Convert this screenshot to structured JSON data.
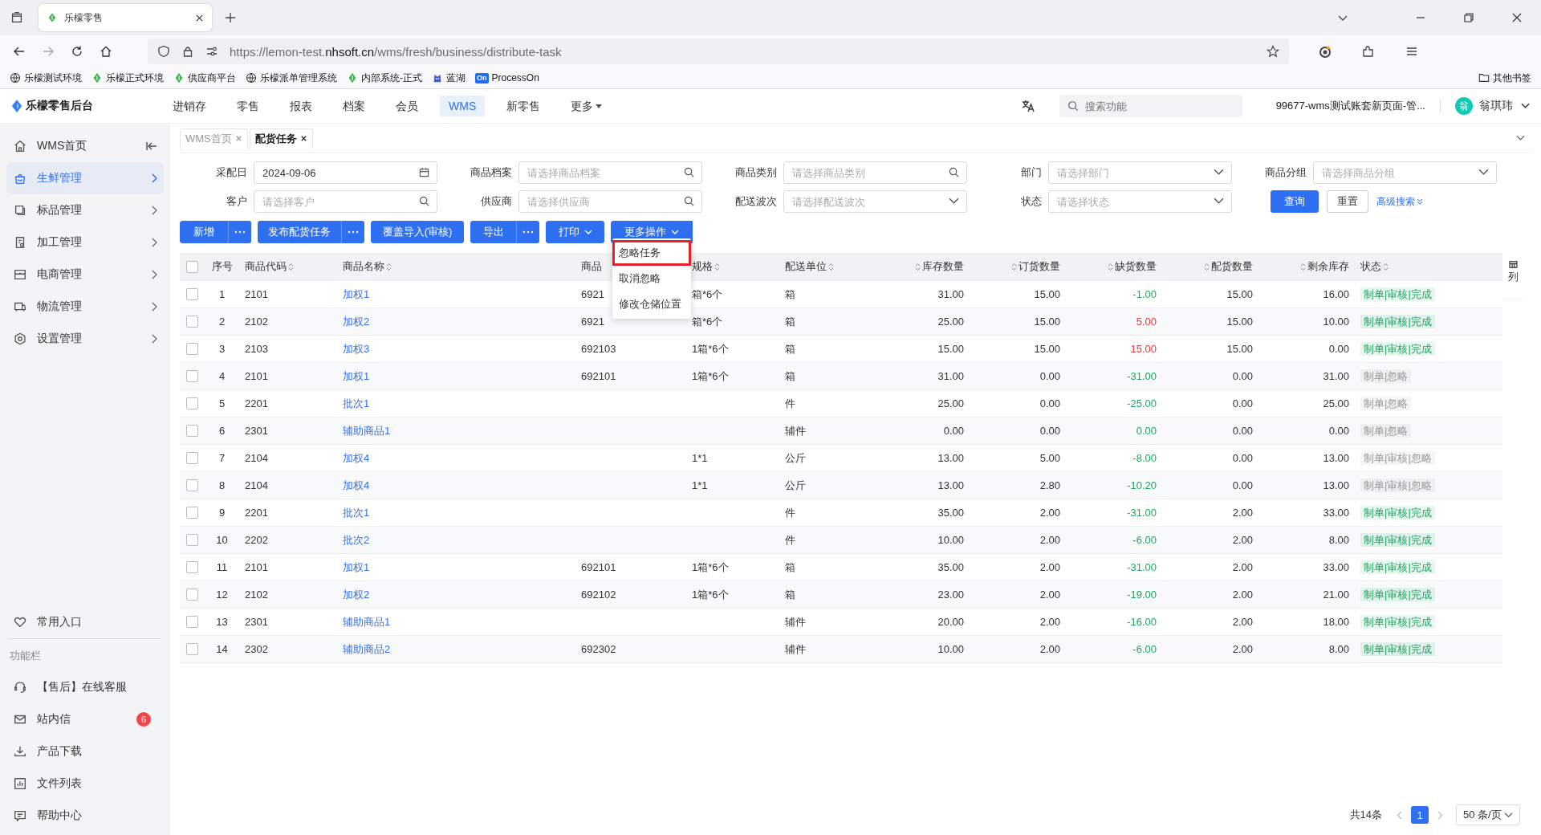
{
  "browser": {
    "tab_title": "乐檬零售",
    "url": "https://lemon-test.**nhsoft.cn**/wms/fresh/business/distribute-task",
    "bookmarks": [
      {
        "label": "乐檬测试环境",
        "kind": "globe"
      },
      {
        "label": "乐檬正式环境",
        "kind": "leaf"
      },
      {
        "label": "供应商平台",
        "kind": "leaf"
      },
      {
        "label": "乐檬派单管理系统",
        "kind": "globe"
      },
      {
        "label": "内部系统-正式",
        "kind": "leaf"
      },
      {
        "label": "蓝湖",
        "kind": "lanhu"
      },
      {
        "label": "ProcessOn",
        "kind": "processon",
        "icon_text": "On"
      }
    ],
    "other_bookmarks": "其他书签"
  },
  "app": {
    "logo": "乐檬零售后台",
    "nav": [
      {
        "label": "进销存",
        "selected": false,
        "has_caret": false
      },
      {
        "label": "零售",
        "selected": false,
        "has_caret": false
      },
      {
        "label": "报表",
        "selected": false,
        "has_caret": false
      },
      {
        "label": "档案",
        "selected": false,
        "has_caret": false
      },
      {
        "label": "会员",
        "selected": false,
        "has_caret": false
      },
      {
        "label": "WMS",
        "selected": true,
        "has_caret": false
      },
      {
        "label": "新零售",
        "selected": false,
        "has_caret": false
      },
      {
        "label": "更多",
        "selected": false,
        "has_caret": true
      }
    ],
    "search_placeholder": "搜索功能",
    "account": "99677-wms测试账套新页面-管...",
    "avatar": "翁",
    "user": "翁琪玮"
  },
  "sidebar": {
    "items": [
      {
        "label": "WMS首页",
        "kind": "home",
        "selected": false
      },
      {
        "label": "生鲜管理",
        "kind": "fresh",
        "selected": true
      },
      {
        "label": "标品管理",
        "kind": "box",
        "selected": false
      },
      {
        "label": "加工管理",
        "kind": "factory",
        "selected": false
      },
      {
        "label": "电商管理",
        "kind": "shop",
        "selected": false
      },
      {
        "label": "物流管理",
        "kind": "truck",
        "selected": false
      },
      {
        "label": "设置管理",
        "kind": "gear",
        "selected": false
      }
    ],
    "favorites": {
      "label": "常用入口",
      "kind": "heart"
    },
    "section_title": "功能栏",
    "tools": [
      {
        "label": "【售后】在线客服",
        "kind": "headset"
      },
      {
        "label": "站内信",
        "kind": "mail",
        "badge": "6"
      },
      {
        "label": "产品下载",
        "kind": "download"
      },
      {
        "label": "文件列表",
        "kind": "chart"
      },
      {
        "label": "帮助中心",
        "kind": "help"
      }
    ]
  },
  "page_tabs": [
    {
      "label": "WMS首页",
      "selected": false
    },
    {
      "label": "配货任务",
      "selected": true
    }
  ],
  "filters": [
    [
      {
        "label": "采配日",
        "value": "2024-09-06",
        "kind": "date"
      },
      {
        "label": "商品档案",
        "placeholder": "请选择商品档案",
        "kind": "search"
      },
      {
        "label": "商品类别",
        "placeholder": "请选择商品类别",
        "kind": "search"
      },
      {
        "label": "部门",
        "placeholder": "请选择部门",
        "kind": "select"
      },
      {
        "label": "商品分组",
        "placeholder": "请选择商品分组",
        "kind": "select"
      }
    ],
    [
      {
        "label": "客户",
        "placeholder": "请选择客户",
        "kind": "search"
      },
      {
        "label": "供应商",
        "placeholder": "请选择供应商",
        "kind": "search"
      },
      {
        "label": "配送波次",
        "placeholder": "请选择配送波次",
        "kind": "select"
      },
      {
        "label": "状态",
        "placeholder": "请选择状态",
        "kind": "select"
      }
    ]
  ],
  "query_button": "查询",
  "reset_button": "重置",
  "advanced_search": "高级搜索",
  "actions": [
    {
      "label": "新增",
      "has_more": true,
      "has_caret": false
    },
    {
      "label": "发布配货任务",
      "has_more": true,
      "has_caret": false
    },
    {
      "label": "覆盖导入(审核)",
      "has_more": false,
      "has_caret": false
    },
    {
      "label": "导出",
      "has_more": true,
      "has_caret": false
    },
    {
      "label": "打印",
      "has_more": false,
      "has_caret": true
    },
    {
      "label": "更多操作",
      "has_more": false,
      "has_caret": true
    }
  ],
  "more_menu": [
    {
      "label": "忽略任务",
      "highlighted": true
    },
    {
      "label": "取消忽略",
      "highlighted": false
    },
    {
      "label": "修改仓储位置",
      "highlighted": false
    }
  ],
  "table": {
    "select_all": {
      "checked": false
    },
    "columns": [
      {
        "label": "序号",
        "kind": "index",
        "sortable": false
      },
      {
        "label": "商品代码",
        "kind": "text",
        "sortable": true
      },
      {
        "label": "商品名称",
        "kind": "text",
        "sortable": true
      },
      {
        "label": "商品",
        "kind": "text",
        "sortable": false
      },
      {
        "label": "规格",
        "kind": "text",
        "sortable": true
      },
      {
        "label": "配送单位",
        "kind": "text",
        "sortable": true
      },
      {
        "label": "库存数量",
        "kind": "number",
        "sortable": true
      },
      {
        "label": "订货数量",
        "kind": "number",
        "sortable": true
      },
      {
        "label": "缺货数量",
        "kind": "number",
        "sortable": true
      },
      {
        "label": "配货数量",
        "kind": "number",
        "sortable": true
      },
      {
        "label": "剩余库存",
        "kind": "number",
        "sortable": true
      },
      {
        "label": "状态",
        "kind": "text",
        "sortable": true
      }
    ],
    "rows": [
      {
        "checked": false,
        "index": "1",
        "code": "2101",
        "name": "加权1",
        "barcode": "6921",
        "spec": "箱*6个",
        "unit": "箱",
        "stock": "31.00",
        "ordered": "15.00",
        "shortage": {
          "text": "-1.00",
          "color": "#1fa462"
        },
        "allocated": "15.00",
        "remaining": "16.00",
        "status": {
          "text": "制单|审核|完成",
          "color": "#1fa462"
        }
      },
      {
        "checked": false,
        "index": "2",
        "code": "2102",
        "name": "加权2",
        "barcode": "6921",
        "spec": "箱*6个",
        "unit": "箱",
        "stock": "25.00",
        "ordered": "15.00",
        "shortage": {
          "text": "5.00",
          "color": "#e5393c"
        },
        "allocated": "15.00",
        "remaining": "10.00",
        "status": {
          "text": "制单|审核|完成",
          "color": "#1fa462"
        }
      },
      {
        "checked": false,
        "index": "3",
        "code": "2103",
        "name": "加权3",
        "barcode": "692103",
        "spec": "1箱*6个",
        "unit": "箱",
        "stock": "15.00",
        "ordered": "15.00",
        "shortage": {
          "text": "15.00",
          "color": "#e5393c"
        },
        "allocated": "15.00",
        "remaining": "0.00",
        "status": {
          "text": "制单|审核|完成",
          "color": "#1fa462"
        }
      },
      {
        "checked": false,
        "index": "4",
        "code": "2101",
        "name": "加权1",
        "barcode": "692101",
        "spec": "1箱*6个",
        "unit": "箱",
        "stock": "31.00",
        "ordered": "0.00",
        "shortage": {
          "text": "-31.00",
          "color": "#1fa462"
        },
        "allocated": "0.00",
        "remaining": "31.00",
        "status": {
          "text": "制单|忽略",
          "color": "#999999"
        }
      },
      {
        "checked": false,
        "index": "5",
        "code": "2201",
        "name": "批次1",
        "unit": "件",
        "stock": "25.00",
        "ordered": "0.00",
        "shortage": {
          "text": "-25.00",
          "color": "#1fa462"
        },
        "allocated": "0.00",
        "remaining": "25.00",
        "status": {
          "text": "制单|忽略",
          "color": "#999999"
        }
      },
      {
        "checked": false,
        "index": "6",
        "code": "2301",
        "name": "辅助商品1",
        "unit": "辅件",
        "stock": "0.00",
        "ordered": "0.00",
        "shortage": {
          "text": "0.00",
          "color": "#1fa462"
        },
        "allocated": "0.00",
        "remaining": "0.00",
        "status": {
          "text": "制单|忽略",
          "color": "#999999"
        }
      },
      {
        "checked": false,
        "index": "7",
        "code": "2104",
        "name": "加权4",
        "spec": "1*1",
        "unit": "公斤",
        "stock": "13.00",
        "ordered": "5.00",
        "shortage": {
          "text": "-8.00",
          "color": "#1fa462"
        },
        "allocated": "0.00",
        "remaining": "13.00",
        "status": {
          "text": "制单|审核|忽略",
          "color": "#999999"
        }
      },
      {
        "checked": false,
        "index": "8",
        "code": "2104",
        "name": "加权4",
        "spec": "1*1",
        "unit": "公斤",
        "stock": "13.00",
        "ordered": "2.80",
        "shortage": {
          "text": "-10.20",
          "color": "#1fa462"
        },
        "allocated": "0.00",
        "remaining": "13.00",
        "status": {
          "text": "制单|审核|忽略",
          "color": "#999999"
        }
      },
      {
        "checked": false,
        "index": "9",
        "code": "2201",
        "name": "批次1",
        "unit": "件",
        "stock": "35.00",
        "ordered": "2.00",
        "shortage": {
          "text": "-31.00",
          "color": "#1fa462"
        },
        "allocated": "2.00",
        "remaining": "33.00",
        "status": {
          "text": "制单|审核|完成",
          "color": "#1fa462"
        }
      },
      {
        "checked": false,
        "index": "10",
        "code": "2202",
        "name": "批次2",
        "unit": "件",
        "stock": "10.00",
        "ordered": "2.00",
        "shortage": {
          "text": "-6.00",
          "color": "#1fa462"
        },
        "allocated": "2.00",
        "remaining": "8.00",
        "status": {
          "text": "制单|审核|完成",
          "color": "#1fa462"
        }
      },
      {
        "checked": false,
        "index": "11",
        "code": "2101",
        "name": "加权1",
        "barcode": "692101",
        "spec": "1箱*6个",
        "unit": "箱",
        "stock": "35.00",
        "ordered": "2.00",
        "shortage": {
          "text": "-31.00",
          "color": "#1fa462"
        },
        "allocated": "2.00",
        "remaining": "33.00",
        "status": {
          "text": "制单|审核|完成",
          "color": "#1fa462"
        }
      },
      {
        "checked": false,
        "index": "12",
        "code": "2102",
        "name": "加权2",
        "barcode": "692102",
        "spec": "1箱*6个",
        "unit": "箱",
        "stock": "23.00",
        "ordered": "2.00",
        "shortage": {
          "text": "-19.00",
          "color": "#1fa462"
        },
        "allocated": "2.00",
        "remaining": "21.00",
        "status": {
          "text": "制单|审核|完成",
          "color": "#1fa462"
        }
      },
      {
        "checked": false,
        "index": "13",
        "code": "2301",
        "name": "辅助商品1",
        "unit": "辅件",
        "stock": "20.00",
        "ordered": "2.00",
        "shortage": {
          "text": "-16.00",
          "color": "#1fa462"
        },
        "allocated": "2.00",
        "remaining": "18.00",
        "status": {
          "text": "制单|审核|完成",
          "color": "#1fa462"
        }
      },
      {
        "checked": false,
        "index": "14",
        "code": "2302",
        "name": "辅助商品2",
        "barcode": "692302",
        "unit": "辅件",
        "stock": "10.00",
        "ordered": "2.00",
        "shortage": {
          "text": "-6.00",
          "color": "#1fa462"
        },
        "allocated": "2.00",
        "remaining": "8.00",
        "status": {
          "text": "制单|审核|完成",
          "color": "#1fa462"
        }
      }
    ],
    "column_settings": "列"
  },
  "pagination": {
    "total": "共14条",
    "pages": [
      {
        "label": "1",
        "selected": true
      }
    ],
    "page_size": "50 条/页"
  }
}
